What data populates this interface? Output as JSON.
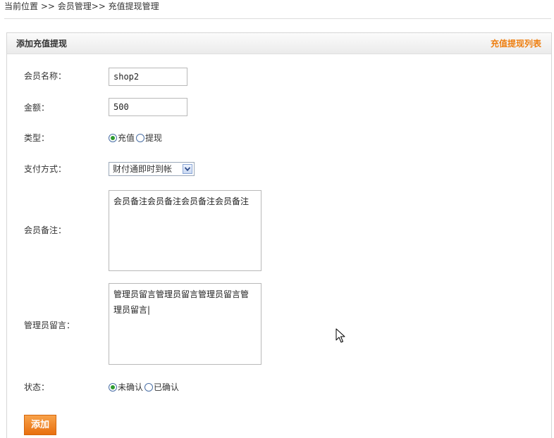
{
  "breadcrumb": {
    "text": "当前位置 >> 会员管理>> 充值提现管理"
  },
  "panel": {
    "title": "添加充值提现",
    "list_link": "充值提现列表"
  },
  "form": {
    "member_name": {
      "label": "会员名称：",
      "value": "shop2"
    },
    "amount": {
      "label": "金额：",
      "value": "500"
    },
    "type": {
      "label": "类型：",
      "options": [
        {
          "label": "充值",
          "checked": true
        },
        {
          "label": "提现",
          "checked": false
        }
      ]
    },
    "payment": {
      "label": "支付方式：",
      "selected": "财付通即时到帐"
    },
    "member_note": {
      "label": "会员备注：",
      "value": "会员备注会员备注会员备注会员备注"
    },
    "admin_message": {
      "label": "管理员留言：",
      "value": "管理员留言管理员留言管理员留言管理员留言|"
    },
    "status": {
      "label": "状态：",
      "options": [
        {
          "label": "未确认",
          "checked": true
        },
        {
          "label": "已确认",
          "checked": false
        }
      ]
    },
    "submit_label": "添加"
  },
  "icons": {
    "select_arrow": "chevron-down-icon",
    "pointer": "mouse-cursor-icon"
  },
  "colors": {
    "accent": "#ee7f11",
    "button": "#f08a24",
    "radio_checked": "#2f9b2f"
  }
}
